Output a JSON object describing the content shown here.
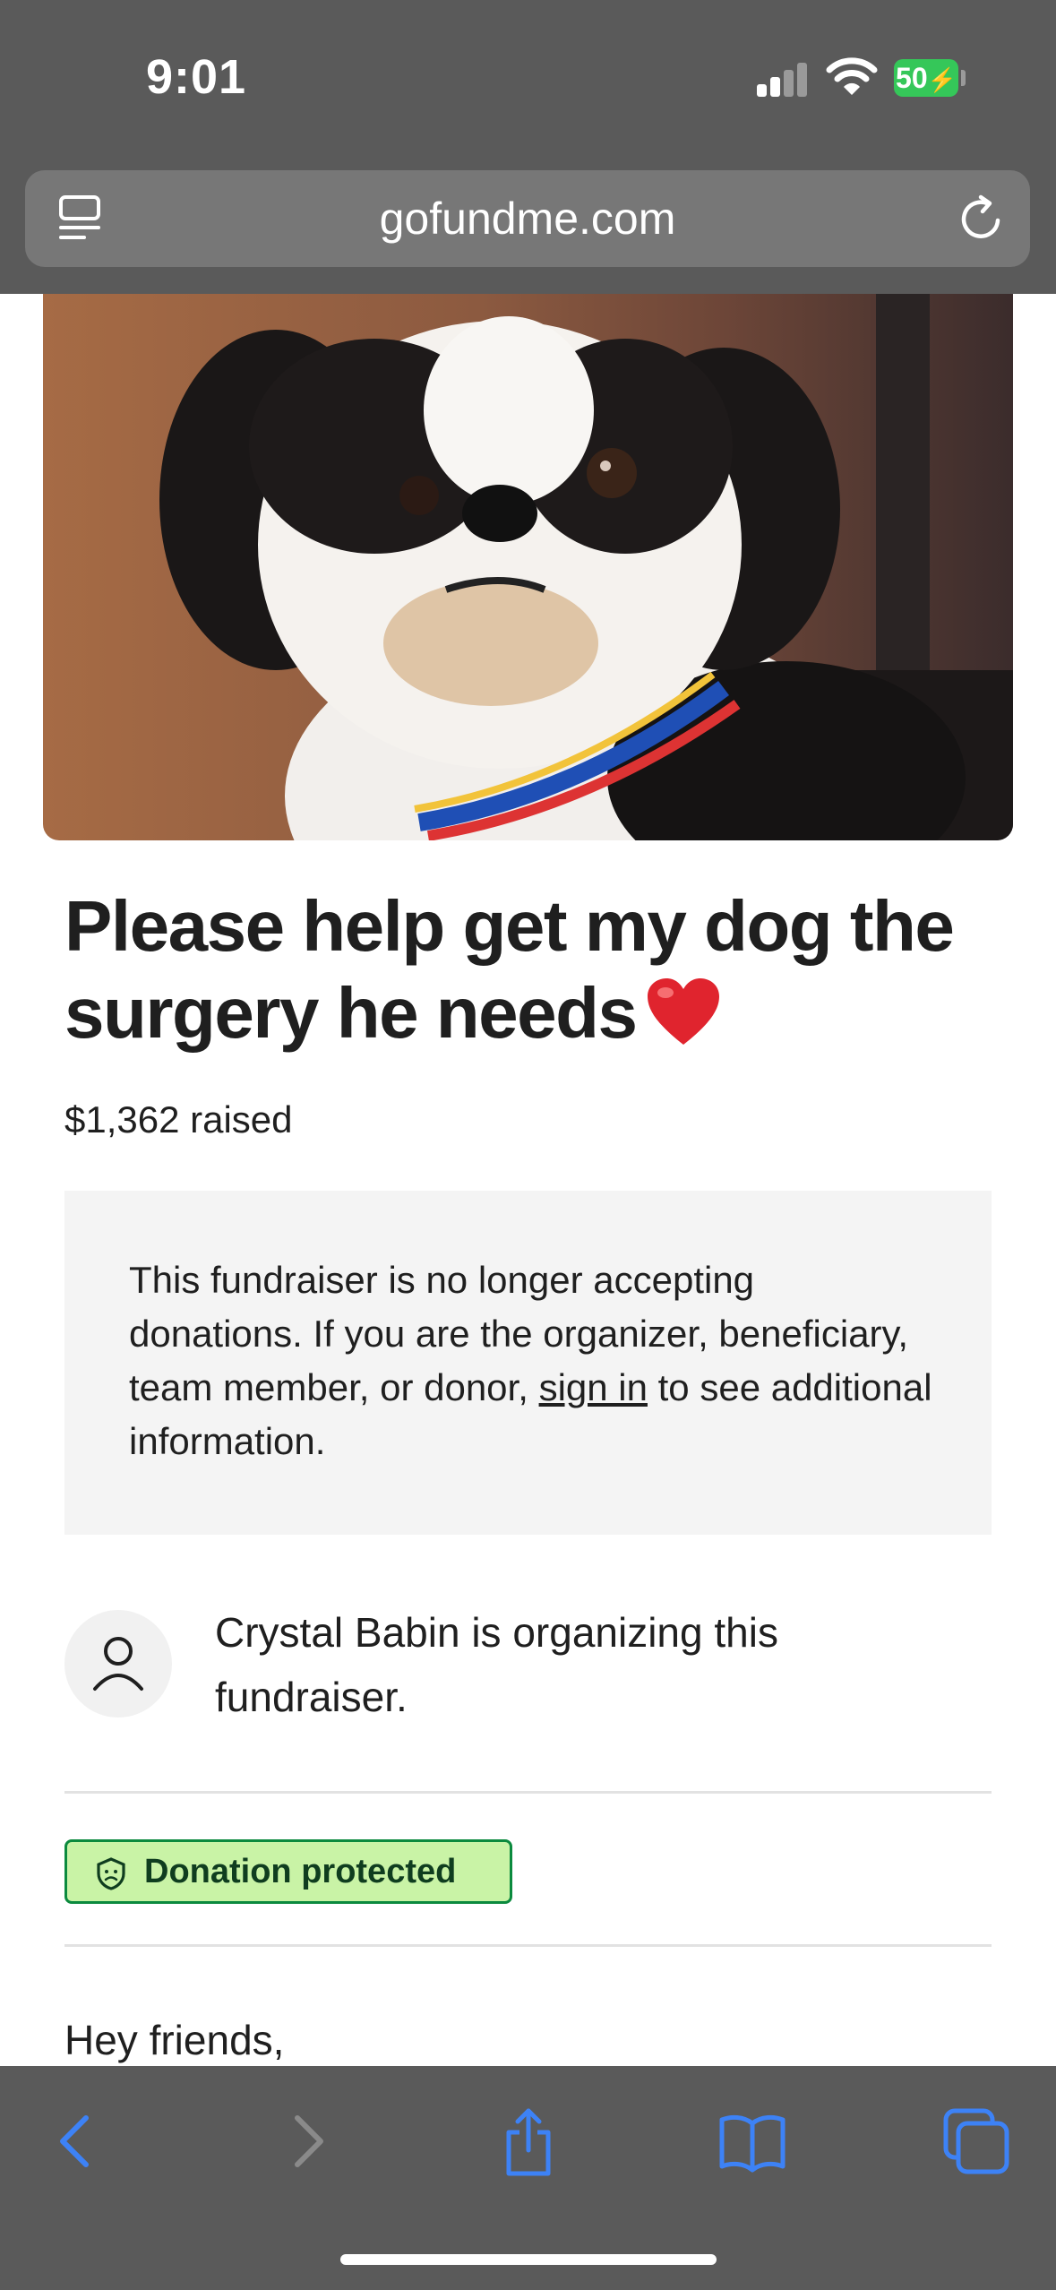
{
  "status_bar": {
    "time": "9:01",
    "battery": "50",
    "signal_icon": "cellular-signal-icon",
    "wifi_icon": "wifi-icon"
  },
  "browser": {
    "url": "gofundme.com",
    "reader_icon": "page-menu-icon",
    "reload_icon": "reload-icon"
  },
  "fundraiser": {
    "title": "Please help get my dog the surgery he needs",
    "title_emoji": "heart",
    "amount_raised": "$1,362 raised",
    "notice_before_link": "This fundraiser is no longer accepting donations. If you are the organizer, beneficiary, team member, or donor, ",
    "notice_link": "sign in",
    "notice_after_link": " to see additional information.",
    "organizer_text": "Crystal Babin is organizing this fundraiser.",
    "badge_label": "Donation protected",
    "story_start": "Hey friends,"
  },
  "toolbar": {
    "icons": [
      "back-icon",
      "forward-icon",
      "share-icon",
      "bookmarks-icon",
      "tabs-icon"
    ]
  },
  "colors": {
    "chrome": "#5a5a5a",
    "accent_blue": "#3d82f6",
    "badge_green": "#c9f3a6",
    "badge_border": "#0b8a3e",
    "battery_green": "#35c759"
  }
}
